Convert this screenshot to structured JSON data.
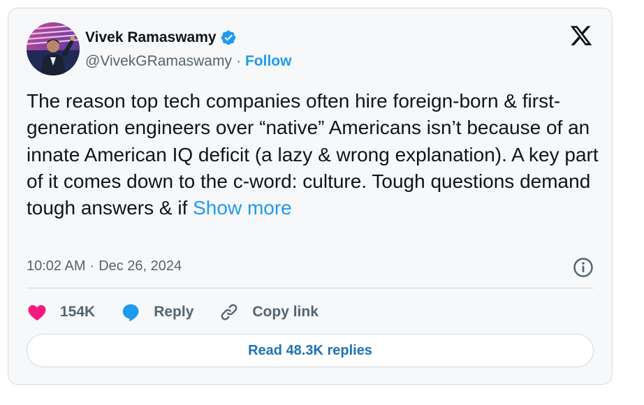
{
  "author": {
    "display_name": "Vivek Ramaswamy",
    "handle": "@VivekGRamaswamy",
    "separator": "·",
    "follow_label": "Follow",
    "verified_color": "#1d9bf0",
    "avatar_icon": "profile-photo-avatar"
  },
  "platform_logo": "x-logo-icon",
  "tweet": {
    "text": "The reason top tech companies often hire foreign-born & first-generation engineers over “native” Americans isn’t because of an innate American IQ deficit (a lazy & wrong explanation). A key part of it comes down to the c-word: culture. Tough questions demand tough answers & if ",
    "show_more_label": "Show more"
  },
  "meta": {
    "time": "10:02 AM",
    "separator": "·",
    "date": "Dec 26, 2024",
    "info_icon": "info-circle-icon"
  },
  "actions": {
    "like_count": "154K",
    "reply_label": "Reply",
    "copy_link_label": "Copy link",
    "like_color": "#f91880",
    "reply_color": "#1d9bf0"
  },
  "read_replies": {
    "label": "Read 48.3K replies"
  },
  "colors": {
    "accent": "#1d9bf0",
    "text_primary": "#0f1419",
    "text_secondary": "#536471",
    "card_background": "#f7f8f9"
  }
}
